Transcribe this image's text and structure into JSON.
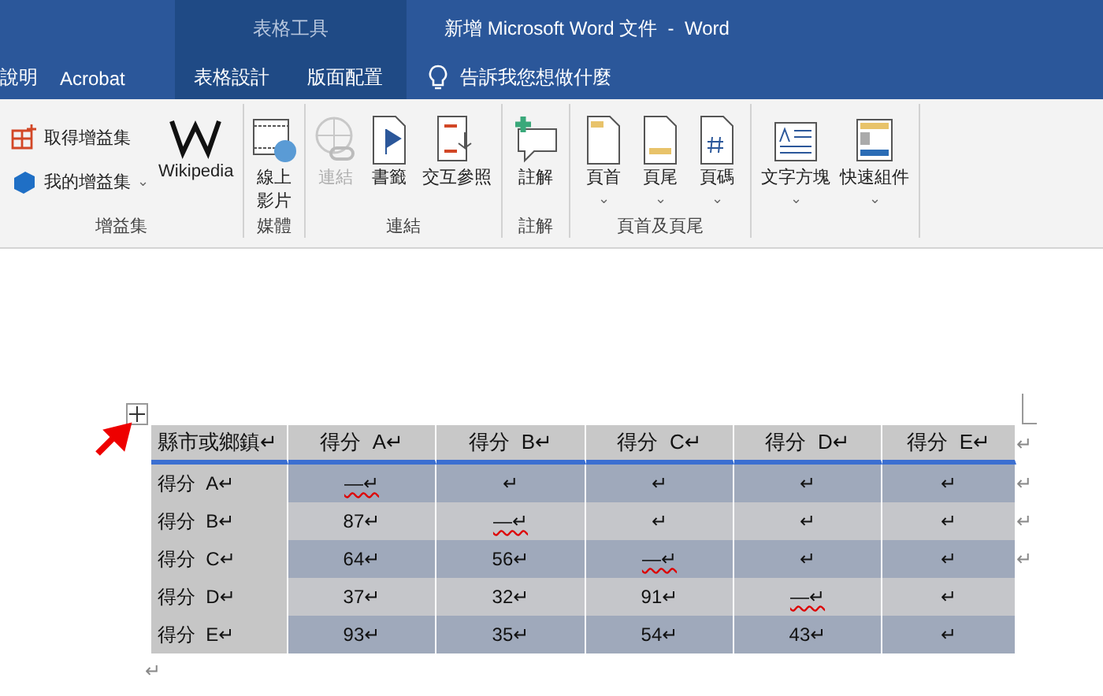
{
  "window": {
    "title": "新增 Microsoft Word 文件  -  Word"
  },
  "tabs": [
    {
      "label": "說明",
      "selected": false
    },
    {
      "label": "Acrobat",
      "selected": false
    }
  ],
  "table_tools": {
    "label": "表格工具",
    "tabs": [
      {
        "label": "表格設計",
        "selected": false
      },
      {
        "label": "版面配置",
        "selected": false
      }
    ]
  },
  "tell_me": "告訴我您想做什麼",
  "ribbon": [
    {
      "label": "增益集",
      "items": [
        {
          "kind": "small",
          "label": "取得增益集"
        },
        {
          "kind": "small",
          "label": "我的增益集",
          "dropdown": "⌄"
        },
        {
          "kind": "large",
          "label": "Wikipedia",
          "disabled": false
        }
      ]
    },
    {
      "label": "媒體",
      "items": [
        {
          "kind": "narrow",
          "label": "線上影片",
          "disabled": false
        }
      ]
    },
    {
      "label": "連結",
      "items": [
        {
          "kind": "narrow",
          "label": "連結",
          "disabled": true
        },
        {
          "kind": "large",
          "label": "書籤",
          "disabled": false
        },
        {
          "kind": "large",
          "label": "交互參照",
          "disabled": false
        }
      ]
    },
    {
      "label": "註解",
      "items": [
        {
          "kind": "large",
          "label": "註解",
          "disabled": false
        }
      ]
    },
    {
      "label": "頁首及頁尾",
      "items": [
        {
          "kind": "large",
          "label": "頁首",
          "dropdown": "⌄",
          "disabled": false
        },
        {
          "kind": "large",
          "label": "頁尾",
          "dropdown": "⌄",
          "disabled": false
        },
        {
          "kind": "large",
          "label": "頁碼",
          "dropdown": "⌄",
          "disabled": false
        }
      ]
    },
    {
      "items": [
        {
          "kind": "large",
          "label": "文字方塊",
          "dropdown": "⌄",
          "disabled": false
        },
        {
          "kind": "large",
          "label": "快速組件",
          "dropdown": "⌄",
          "disabled": false
        }
      ]
    }
  ],
  "table": {
    "columns": [
      "縣市或鄉鎮↵",
      "得分  A↵",
      "得分  B↵",
      "得分  C↵",
      "得分  D↵",
      "得分  E↵"
    ],
    "header_end": "↵",
    "rows": [
      {
        "cells": [
          {
            "text": "得分  A↵"
          },
          {
            "text": "—↵",
            "flagged": true
          },
          {
            "text": "↵"
          },
          {
            "text": "↵"
          },
          {
            "text": "↵"
          },
          {
            "text": "↵"
          }
        ],
        "end_mark": "↵"
      },
      {
        "cells": [
          {
            "text": "得分  B↵"
          },
          {
            "text": "87↵"
          },
          {
            "text": "—↵",
            "flagged": true
          },
          {
            "text": "↵"
          },
          {
            "text": "↵"
          },
          {
            "text": "↵"
          }
        ],
        "end_mark": "↵"
      },
      {
        "cells": [
          {
            "text": "得分  C↵"
          },
          {
            "text": "64↵"
          },
          {
            "text": "56↵"
          },
          {
            "text": "—↵",
            "flagged": true
          },
          {
            "text": "↵"
          },
          {
            "text": "↵"
          }
        ],
        "end_mark": "↵"
      },
      {
        "cells": [
          {
            "text": "得分  D↵"
          },
          {
            "text": "37↵"
          },
          {
            "text": "32↵"
          },
          {
            "text": "91↵"
          },
          {
            "text": "—↵",
            "flagged": true
          },
          {
            "text": "↵"
          }
        ]
      },
      {
        "cells": [
          {
            "text": "得分  E↵"
          },
          {
            "text": "93↵"
          },
          {
            "text": "35↵"
          },
          {
            "text": "54↵"
          },
          {
            "text": "43↵"
          },
          {
            "text": "↵"
          }
        ]
      }
    ]
  },
  "after_table": "↵"
}
